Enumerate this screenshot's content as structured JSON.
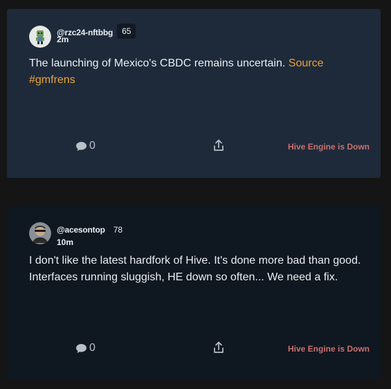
{
  "posts": [
    {
      "username": "@rzc24-nftbbg",
      "reputation": "65",
      "time": "2m",
      "text": "The launching of Mexico's CBDC remains uncertain.",
      "link_text": "Source",
      "hashtag": "#gmfrens",
      "comments": "0",
      "status": "Hive Engine is Down"
    },
    {
      "username": "@acesontop",
      "reputation": "78",
      "time": "10m",
      "text": "I don't like the latest hardfork of Hive. It's done more bad than good. Interfaces running sluggish, HE down so often... We need a fix.",
      "comments": "0",
      "status": "Hive Engine is Down"
    }
  ],
  "colors": {
    "background": "#151515",
    "card_highlight": "#1e2a3a",
    "card_normal": "#0f1720",
    "link": "#e8a33b",
    "status": "#c9706f"
  },
  "icons": [
    "comment-icon",
    "share-icon"
  ]
}
